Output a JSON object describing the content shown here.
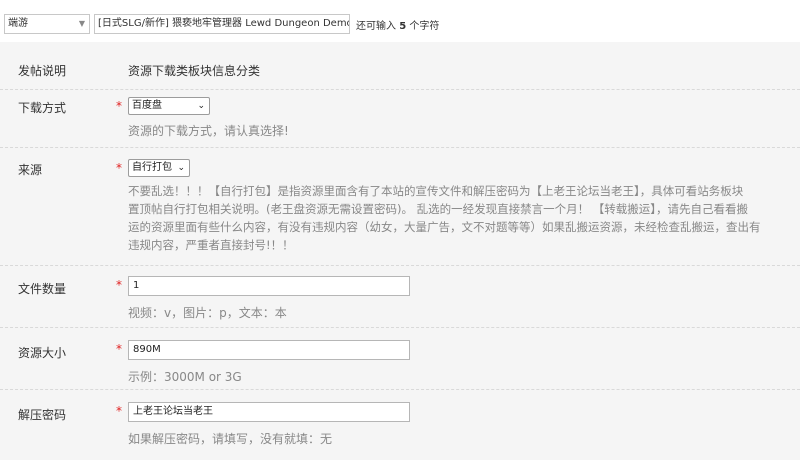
{
  "title_row": {
    "type_value": "端游",
    "title_value": "[日式SLG/新作] 猥亵地牢管理器 Lewd Dungeon  Demo 官",
    "hint_prefix": "还可输入",
    "hint_count": "5",
    "hint_suffix": "个字符"
  },
  "form": {
    "info": {
      "label": "发帖说明",
      "value": "资源下载类板块信息分类"
    },
    "download_method": {
      "label": "下载方式",
      "required": "*",
      "selected": "百度盘",
      "help": "资源的下载方式，请认真选择!"
    },
    "source": {
      "label": "来源",
      "required": "*",
      "selected": "自行打包",
      "help_lines": [
        "不要乱选！！！【自行打包】是指资源里面含有了本站的宣传文件和解压密码为【上老王论坛当老王】，具体可看站务板块",
        "置顶帖自行打包相关说明。(老王盘资源无需设置密码)。 乱选的一经发现直接禁言一个月！ 【转载搬运】，请先自己看看搬",
        "运的资源里面有些什么内容，有没有违规内容（幼女，大量广告，文不对题等等）如果乱搬运资源，未经检查乱搬运，查出有",
        "违规内容，严重者直接封号!！！"
      ]
    },
    "file_count": {
      "label": "文件数量",
      "required": "*",
      "value": "1",
      "help": "视频：v，图片：p，文本：本"
    },
    "size": {
      "label": "资源大小",
      "required": "*",
      "value": "890M",
      "help": "示例：3000M or 3G"
    },
    "password": {
      "label": "解压密码",
      "required": "*",
      "value": "上老王论坛当老王",
      "help": "如果解压密码，请填写，没有就填：无"
    }
  }
}
